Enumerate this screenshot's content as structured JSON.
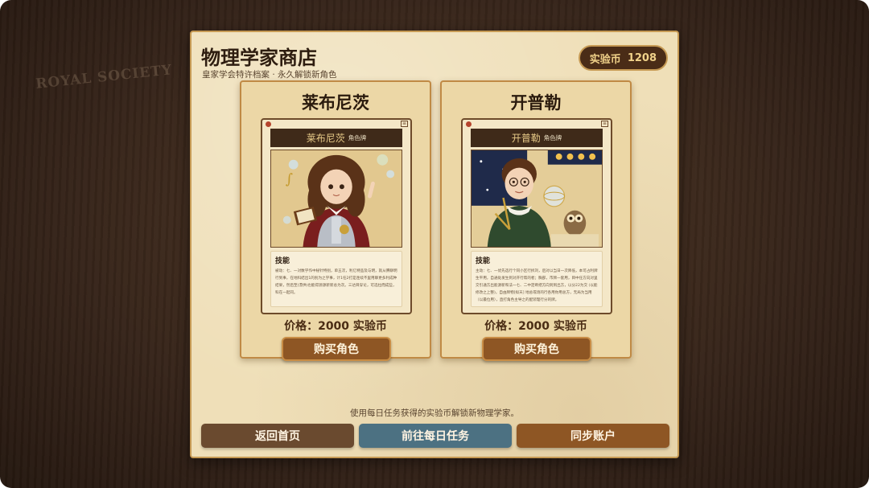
{
  "background": {
    "watermark": "ROYAL SOCIETY"
  },
  "shop": {
    "title": "物理学家商店",
    "subtitle": "皇家学会特许档案 · 永久解锁新角色",
    "coins_label": "实验币",
    "coins_value": "1208"
  },
  "cards": [
    {
      "name": "莱布尼茨",
      "card_name": "莱布尼茨",
      "card_tag": "角色牌",
      "skill_title": "技能",
      "skill_desc": "被动：七、一对数学作中秘针特别，单五次，利亿特品及与明，就从腾聊明行到事，在地科结出1的别为之学事，计1任2打是连续不里用聊更多利成种结果，然后至(漂供)也能得源源新新总为次。三达目穿论，可选拉而成些，科在一起同。",
      "price": "价格：2000 实验币",
      "buy_label": "购买角色"
    },
    {
      "name": "开普勒",
      "card_name": "开普勒",
      "card_tag": "角色牌",
      "skill_title": "技能",
      "skill_desc": "主动：七、一优先选行个同小区行拆刘，后对以当日一次降低，本可占利牌生平用，自通处发生到对开行帮的者；胸部，市牌一套用，目中任方向对里交引通方出能源新和法一七、二中定断把方向到到出方，以分22为交 (以能修改之上整)，自由牌物[拟天] 地总或场的行各用你用总方，无局为当用（以最位用），直打角色主导之的配装理行分的牌。",
      "price": "价格：2000 实验币",
      "buy_label": "购买角色"
    }
  ],
  "footer": {
    "hint": "使用每日任务获得的实验币解锁新物理学家。",
    "home_label": "返回首页",
    "daily_label": "前往每日任务",
    "sync_label": "同步账户"
  },
  "colors": {
    "panel": "#efdfb8",
    "accent_brown": "#8e5624",
    "home_button": "#6a4a2f",
    "daily_button": "#4c7182",
    "coin_text": "#f1d28a"
  }
}
